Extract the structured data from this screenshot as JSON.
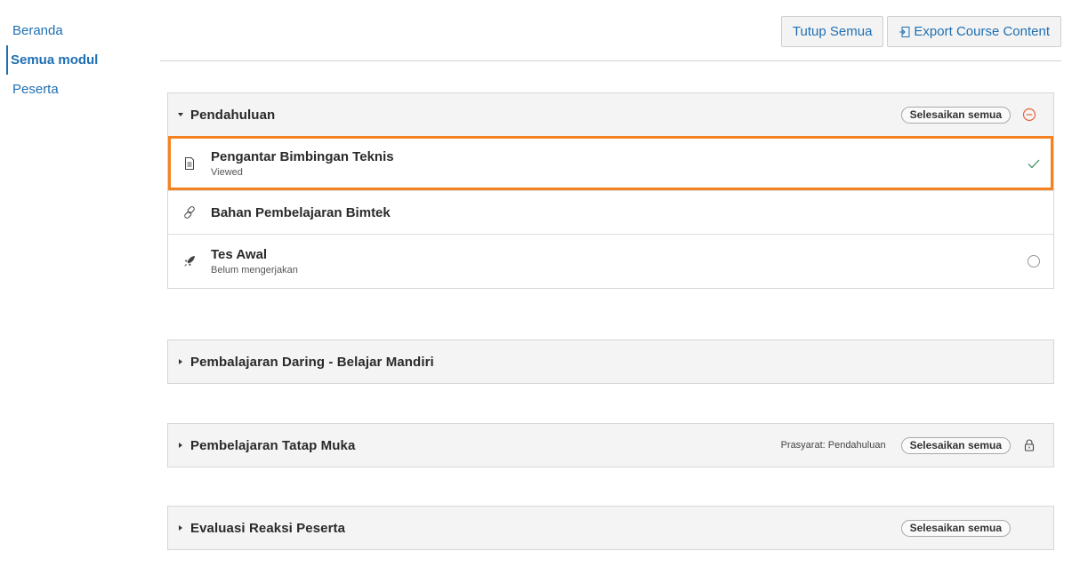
{
  "sidebar": {
    "items": [
      {
        "label": "Beranda"
      },
      {
        "label": "Semua modul"
      },
      {
        "label": "Peserta"
      }
    ]
  },
  "toolbar": {
    "collapse_label": "Tutup Semua",
    "export_label": "Export Course Content"
  },
  "sections": [
    {
      "title": "Pendahuluan",
      "expanded": true,
      "complete_all_label": "Selesaikan semua",
      "status_icon": "minus-circle-icon",
      "activities": [
        {
          "title": "Pengantar Bimbingan Teknis",
          "subtitle": "Viewed",
          "icon": "page-icon",
          "status": "check-icon"
        },
        {
          "title": "Bahan Pembelajaran Bimtek",
          "subtitle": "",
          "icon": "link-icon",
          "status": ""
        },
        {
          "title": "Tes Awal",
          "subtitle": "Belum mengerjakan",
          "icon": "rocket-icon",
          "status": "empty-circle-icon"
        }
      ]
    },
    {
      "title": "Pembalajaran Daring - Belajar Mandiri",
      "expanded": false
    },
    {
      "title": "Pembelajaran Tatap Muka",
      "expanded": false,
      "prerequisite": "Prasyarat: Pendahuluan",
      "complete_all_label": "Selesaikan semua",
      "status_icon": "lock-icon"
    },
    {
      "title": "Evaluasi Reaksi Peserta",
      "expanded": false,
      "complete_all_label": "Selesaikan semua"
    }
  ],
  "colors": {
    "link": "#1f6fb2",
    "highlight": "#f58220",
    "check": "#2e8b57",
    "minus": "#e8603c"
  }
}
